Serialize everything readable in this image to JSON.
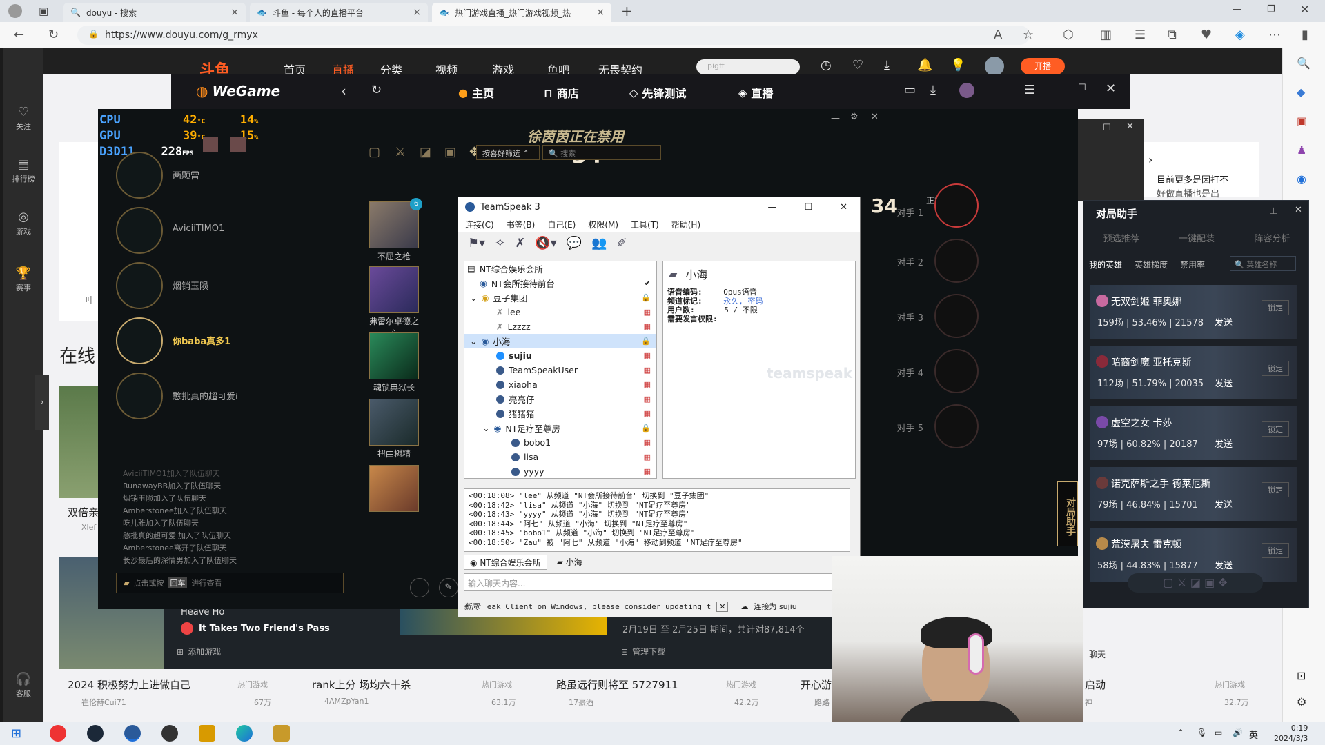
{
  "browser": {
    "tabs": [
      {
        "title": "douyu - 搜索"
      },
      {
        "title": "斗鱼 - 每个人的直播平台"
      },
      {
        "title": "热门游戏直播_热门游戏视频_热"
      }
    ],
    "url": "https://www.douyu.com/g_rmyx"
  },
  "douyu": {
    "nav": [
      "首页",
      "直播",
      "分类",
      "视频",
      "游戏",
      "鱼吧",
      "无畏契约"
    ],
    "search_placeholder": "pigff",
    "sidebar": [
      {
        "label": "关注"
      },
      {
        "label": "排行榜"
      },
      {
        "label": "游戏"
      },
      {
        "label": "赛事"
      },
      {
        "label": "客服"
      }
    ],
    "section_title": "在线",
    "left_card_title": "双倍亲",
    "left_card_meta": "Xlef",
    "left_card_text": "叶",
    "add_game": "添加游戏",
    "manage_download": "管理下载",
    "game_item_1": "Heave Ho",
    "game_item_2": "It Takes Two Friend's Pass",
    "banner_date": "2月19日 至 2月25日 期间，共计对87,814个",
    "right_promo_line1": "目前更多是因打不",
    "right_promo_line2": "好做直播也是出",
    "bottom_cards": [
      {
        "title": "2024 积极努力上进做自己",
        "tag": "热门游戏",
        "author": "崔伦赫Cui71",
        "views": "67万"
      },
      {
        "title": "rank上分 场均六十杀",
        "tag": "热门游戏",
        "author": "4AMZpYan1",
        "views": "63.1万"
      },
      {
        "title": "路虽远行则将至 5727911",
        "tag": "热门游戏",
        "author": "17豪酒",
        "views": "42.2万"
      },
      {
        "title": "开心游",
        "tag": "",
        "author": "路路",
        "views": ""
      },
      {
        "title": "启动",
        "tag": "热门游戏",
        "author": "神",
        "views": "32.7万"
      }
    ],
    "open_live": "开播",
    "chat_label": "聊天"
  },
  "wegame": {
    "logo": "WeGame",
    "nav": [
      "主页",
      "商店",
      "先锋测试",
      "直播"
    ]
  },
  "overlay": {
    "cpu_label": "CPU",
    "cpu_temp": "42",
    "cpu_pct": "14",
    "gpu_label": "GPU",
    "gpu_temp": "39",
    "gpu_pct": "15",
    "api_label": "D3D11",
    "fps": "228",
    "fps_unit": "FPS",
    "temp_unit": "°C",
    "pct_unit": "%"
  },
  "lol": {
    "banning_text": "徐茵茵正在禁用",
    "timer": "34",
    "timer_right": "34",
    "enemy_banning": "正在禁用......",
    "filter_label": "按喜好筛选",
    "search_placeholder": "搜索",
    "allies": [
      "两颗雷",
      "AviciiTIMO1",
      "烟销玉陨",
      "你baba真多1",
      "憨批真的超可爱i"
    ],
    "enemies": [
      "对手 1",
      "对手 2",
      "对手 3",
      "对手 4",
      "对手 5"
    ],
    "champions": [
      {
        "name": "不屈之枪",
        "badge": "6"
      },
      {
        "name": "弗雷尔卓德之心"
      },
      {
        "name": "魂锁典狱长"
      },
      {
        "name": "扭曲树精"
      },
      {
        "name": ""
      }
    ],
    "chat_log": [
      "AviciiTIMO1加入了队伍聊天",
      "RunawayBB加入了队伍聊天",
      "烟销玉陨加入了队伍聊天",
      "Amberstonee加入了队伍聊天",
      "吃儿雅加入了队伍聊天",
      "憨批真的超可爱i加入了队伍聊天",
      "Amberstonee离开了队伍聊天",
      "长沙最后的深情男加入了队伍聊天"
    ],
    "chat_input_hint": "点击或按",
    "chat_input_key": "回车",
    "chat_input_suffix": "进行查看"
  },
  "teamspeak": {
    "title": "TeamSpeak 3",
    "menu": [
      "连接(C)",
      "书签(B)",
      "自己(E)",
      "权限(M)",
      "工具(T)",
      "帮助(H)"
    ],
    "tree": [
      {
        "label": "NT综合娱乐会所",
        "level": 0
      },
      {
        "label": "NT会所接待前台",
        "level": 1
      },
      {
        "label": "豆子集团",
        "level": 1
      },
      {
        "label": "lee",
        "level": 2
      },
      {
        "label": "Lzzzz",
        "level": 2
      },
      {
        "label": "小海",
        "level": 1,
        "selected": true
      },
      {
        "label": "sujiu",
        "level": 2,
        "bold": true
      },
      {
        "label": "TeamSpeakUser",
        "level": 2
      },
      {
        "label": "xiaoha",
        "level": 2
      },
      {
        "label": "亮亮仔",
        "level": 2
      },
      {
        "label": "猪猪猪",
        "level": 2
      },
      {
        "label": "NT足疗至尊房",
        "level": 2
      },
      {
        "label": "bobo1",
        "level": 3
      },
      {
        "label": "lisa",
        "level": 3
      },
      {
        "label": "yyyy",
        "level": 3
      }
    ],
    "info": {
      "channel": "小海",
      "codec_label": "语音编码:",
      "codec_value": "Opus语音",
      "flags_label": "频道标记:",
      "flags_value": "永久, 密码",
      "users_label": "用户数:",
      "users_value": "5 / 不限",
      "talk_label": "需要发言权限:",
      "watermark": "teamspeak"
    },
    "log": [
      "<00:18:08> \"lee\" 从频道 \"NT会所接待前台\" 切换到 \"豆子集团\"",
      "<00:18:42> \"lisa\" 从频道 \"小海\" 切换到 \"NT足疗至尊房\"",
      "<00:18:43> \"yyyy\" 从频道 \"小海\" 切换到 \"NT足疗至尊房\"",
      "<00:18:44> \"阿七\" 从频道 \"小海\" 切换到 \"NT足疗至尊房\"",
      "<00:18:45> \"bobo1\" 从频道 \"小海\" 切换到 \"NT足疗至尊房\"",
      "<00:18:50> \"Zau\" 被 \"阿七\" 从频道 \"小海\" 移动到频道 \"NT足疗至尊房\""
    ],
    "tabs": [
      "NT综合娱乐会所",
      "小海"
    ],
    "chat_placeholder": "输入聊天内容...",
    "status_news_label": "新闻:",
    "status_news": "eak Client on Windows, please consider updating t",
    "status_connected": "连接为 sujiu"
  },
  "helper": {
    "title": "对局助手",
    "tabs_top": [
      "预选推荐",
      "一键配装",
      "阵容分析"
    ],
    "tabs": [
      "我的英雄",
      "英雄梯度",
      "禁用率"
    ],
    "search_placeholder": "英雄名称",
    "lock_label": "锁定",
    "send_label": "发送",
    "side_tab": "对局助手",
    "heroes": [
      {
        "name": "无双剑姬 菲奥娜",
        "stats": "159场 | 53.46% | 21578"
      },
      {
        "name": "暗裔剑魔 亚托克斯",
        "stats": "112场 | 51.79% | 20035"
      },
      {
        "name": "虚空之女 卡莎",
        "stats": "97场 | 60.82% | 20187"
      },
      {
        "name": "诺克萨斯之手 德莱厄斯",
        "stats": "79场 | 46.84% | 15701"
      },
      {
        "name": "荒漠屠夫 雷克顿",
        "stats": "58场 | 44.83% | 15877"
      }
    ]
  },
  "taskbar": {
    "time": "0:19",
    "date": "2024/3/3",
    "ime": "英"
  }
}
